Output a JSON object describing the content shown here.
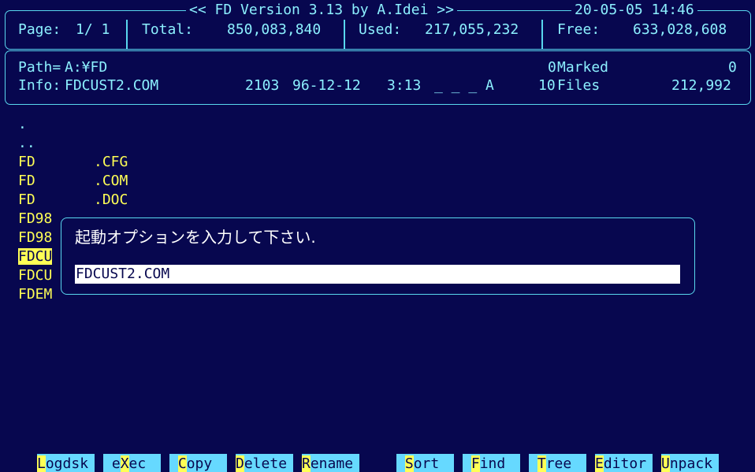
{
  "header": {
    "title": "<< FD Version 3.13 by A.Idei >>",
    "datetime": "20-05-05 14:46",
    "page_label": "Page:",
    "page_value": "1/ 1",
    "total_label": "Total:",
    "total_value": "850,083,840",
    "used_label": "Used:",
    "used_value": "217,055,232",
    "free_label": "Free:",
    "free_value": "633,028,608"
  },
  "info": {
    "path_label": "Path=",
    "path_value": "A:¥FD",
    "marked_count": "0",
    "marked_label": "Marked",
    "marked_size": "0",
    "info_label": "Info:",
    "file_name": "FDCUST2.COM",
    "file_size": "2103",
    "file_date": "96-12-12",
    "file_time": "3:13",
    "file_attrs": "_ _ _ A",
    "files_count": "10",
    "files_label": "Files",
    "files_size": "212,992"
  },
  "files": [
    {
      "name": ".",
      "ext": ""
    },
    {
      "name": "..",
      "ext": ""
    },
    {
      "name": "FD",
      "ext": ".CFG"
    },
    {
      "name": "FD",
      "ext": ".COM"
    },
    {
      "name": "FD",
      "ext": ".DOC"
    },
    {
      "name": "FD98",
      "ext": ""
    },
    {
      "name": "FD98",
      "ext": ""
    },
    {
      "name": "FDCU",
      "ext": ""
    },
    {
      "name": "FDCU",
      "ext": ""
    },
    {
      "name": "FDEM",
      "ext": ""
    }
  ],
  "dialog": {
    "prompt": "起動オプションを入力して下さい.",
    "input_value": "FDCUST2.COM"
  },
  "fkeys": [
    {
      "hot": "L",
      "rest": "ogdsk"
    },
    {
      "pre": " e",
      "hot": "X",
      "rest": "ec"
    },
    {
      "pre": " ",
      "hot": "C",
      "rest": "opy"
    },
    {
      "hot": "D",
      "rest": "elete"
    },
    {
      "hot": "R",
      "rest": "ename"
    },
    {
      "pre": " ",
      "hot": "S",
      "rest": "ort"
    },
    {
      "pre": " ",
      "hot": "F",
      "rest": "ind"
    },
    {
      "pre": " ",
      "hot": "T",
      "rest": "ree"
    },
    {
      "hot": "E",
      "rest": "ditor"
    },
    {
      "hot": "U",
      "rest": "npack"
    }
  ],
  "colors": {
    "background": "#07074f",
    "text": "#8cf0ff",
    "highlight": "#ffff55",
    "fkey_bg": "#66d9ff"
  }
}
